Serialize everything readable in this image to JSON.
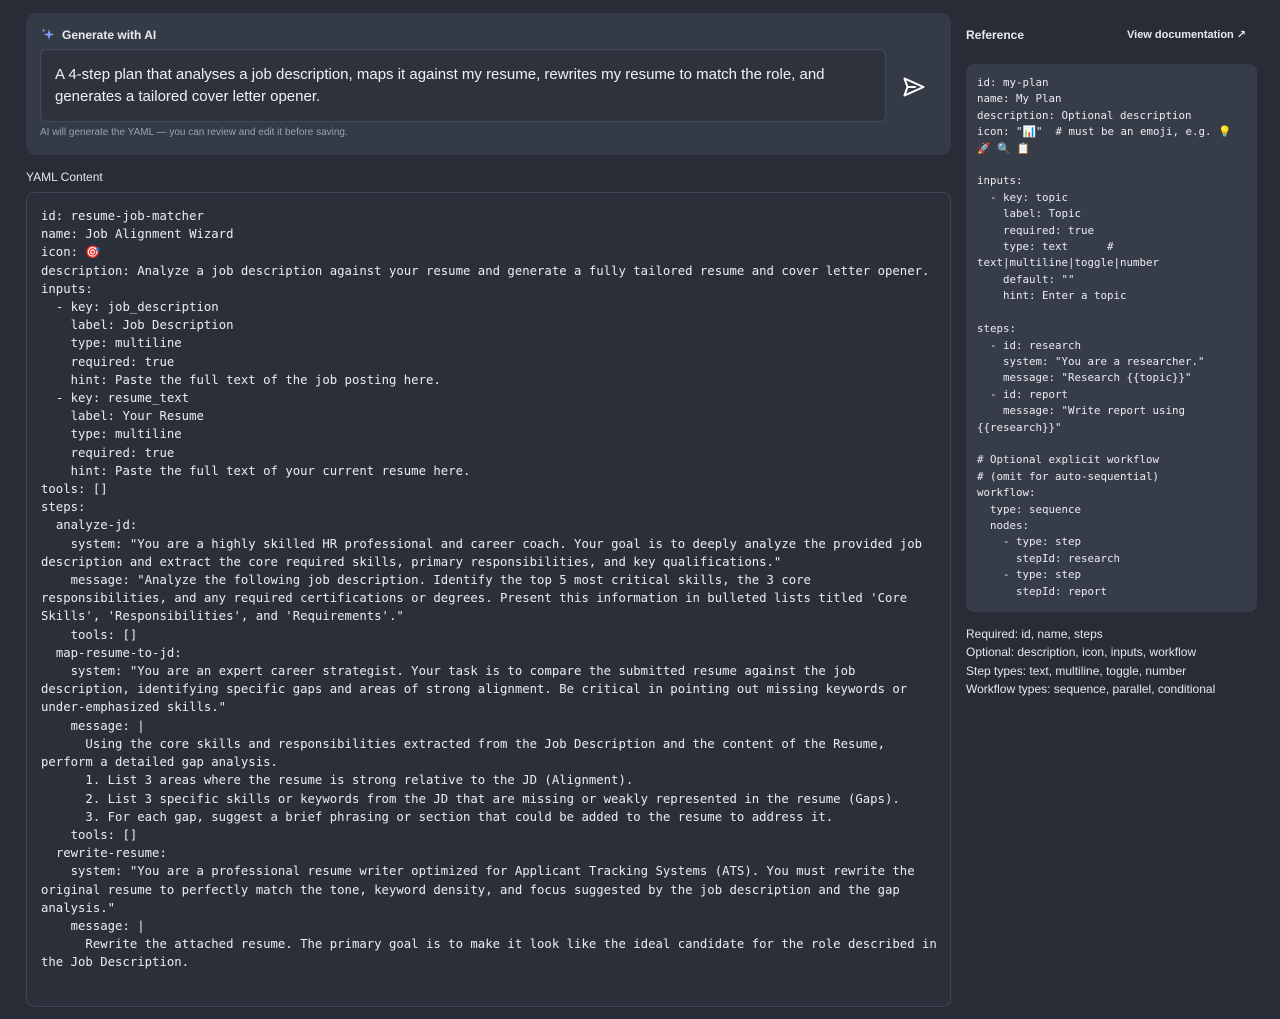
{
  "generate": {
    "title": "Generate with AI",
    "prompt": "A 4-step plan that analyses a job description, maps it against my resume, rewrites my resume to match the role, and generates a tailored cover letter opener.",
    "hint": "AI will generate the YAML — you can review and edit it before saving."
  },
  "yaml": {
    "label": "YAML Content",
    "content": "id: resume-job-matcher\nname: Job Alignment Wizard\nicon: 🎯\ndescription: Analyze a job description against your resume and generate a fully tailored resume and cover letter opener.\ninputs:\n  - key: job_description\n    label: Job Description\n    type: multiline\n    required: true\n    hint: Paste the full text of the job posting here.\n  - key: resume_text\n    label: Your Resume\n    type: multiline\n    required: true\n    hint: Paste the full text of your current resume here.\ntools: []\nsteps:\n  analyze-jd:\n    system: \"You are a highly skilled HR professional and career coach. Your goal is to deeply analyze the provided job description and extract the core required skills, primary responsibilities, and key qualifications.\"\n    message: \"Analyze the following job description. Identify the top 5 most critical skills, the 3 core responsibilities, and any required certifications or degrees. Present this information in bulleted lists titled 'Core Skills', 'Responsibilities', and 'Requirements'.\"\n    tools: []\n  map-resume-to-jd:\n    system: \"You are an expert career strategist. Your task is to compare the submitted resume against the job description, identifying specific gaps and areas of strong alignment. Be critical in pointing out missing keywords or under-emphasized skills.\"\n    message: |\n      Using the core skills and responsibilities extracted from the Job Description and the content of the Resume, perform a detailed gap analysis.\n      1. List 3 areas where the resume is strong relative to the JD (Alignment).\n      2. List 3 specific skills or keywords from the JD that are missing or weakly represented in the resume (Gaps).\n      3. For each gap, suggest a brief phrasing or section that could be added to the resume to address it.\n    tools: []\n  rewrite-resume:\n    system: \"You are a professional resume writer optimized for Applicant Tracking Systems (ATS). You must rewrite the original resume to perfectly match the tone, keyword density, and focus suggested by the job description and the gap analysis.\"\n    message: |\n      Rewrite the attached resume. The primary goal is to make it look like the ideal candidate for the role described in the Job Description."
  },
  "reference": {
    "title": "Reference",
    "doc_link": "View documentation ↗",
    "content": "id: my-plan\nname: My Plan\ndescription: Optional description\nicon: \"📊\"  # must be an emoji, e.g. 💡 🚀 🔍 📋\n\ninputs:\n  - key: topic\n    label: Topic\n    required: true\n    type: text      # text|multiline|toggle|number\n    default: \"\"\n    hint: Enter a topic\n\nsteps:\n  - id: research\n    system: \"You are a researcher.\"\n    message: \"Research {{topic}}\"\n  - id: report\n    message: \"Write report using {{research}}\"\n\n# Optional explicit workflow\n# (omit for auto-sequential)\nworkflow:\n  type: sequence\n  nodes:\n    - type: step\n      stepId: research\n    - type: step\n      stepId: report",
    "notes": [
      "Required: id, name, steps",
      "Optional: description, icon, inputs, workflow",
      "Step types: text, multiline, toggle, number",
      "Workflow types: sequence, parallel, conditional"
    ]
  },
  "icons": {
    "generate": "sparkle-icon",
    "send": "send-icon"
  },
  "colors": {
    "background": "#282c36",
    "panel": "#353a47",
    "accent": "#7f9cf5"
  }
}
